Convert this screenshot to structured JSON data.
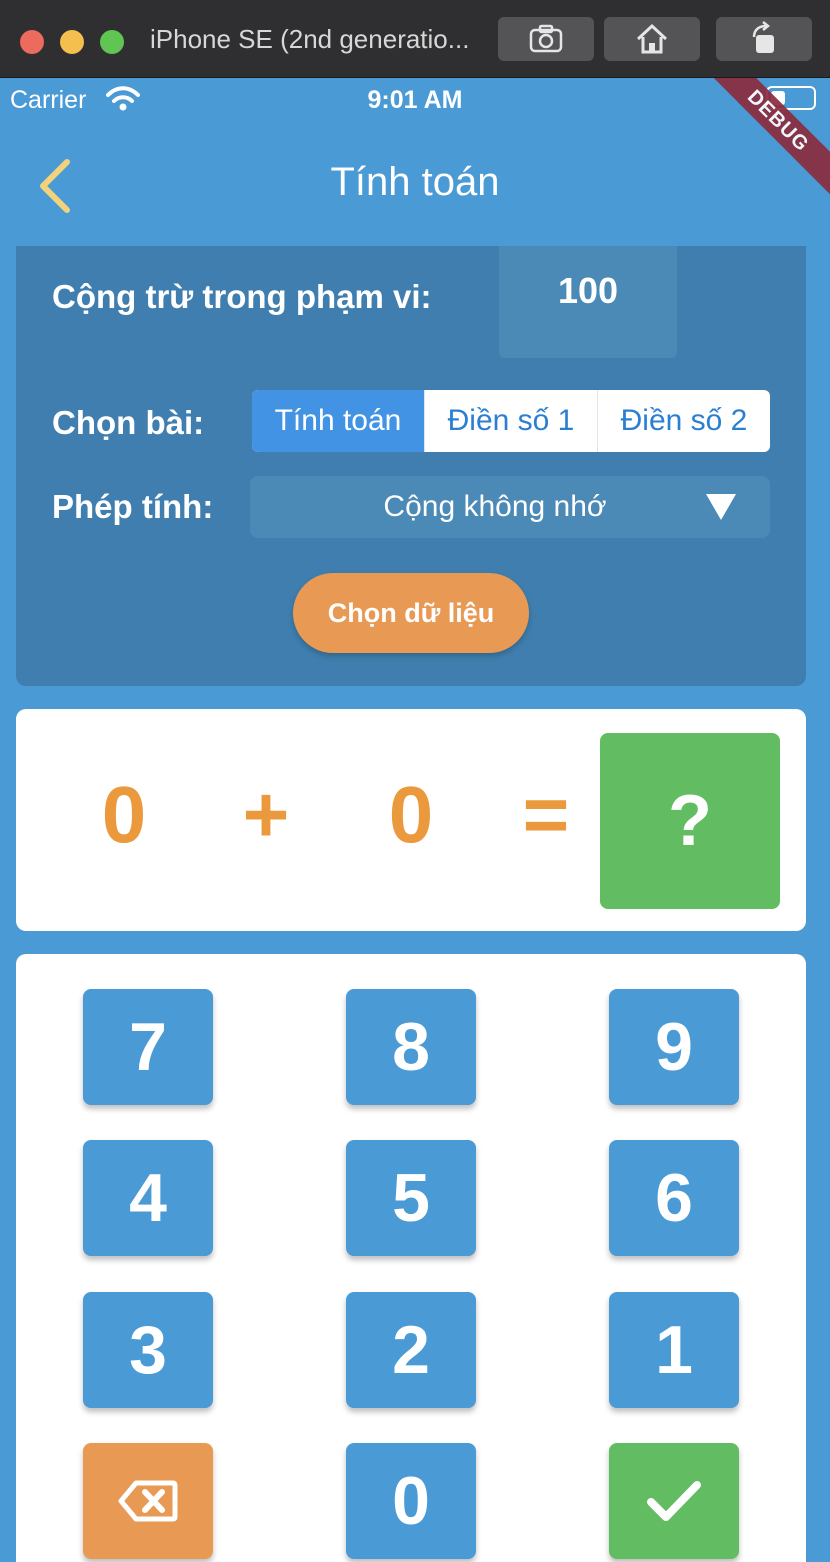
{
  "window": {
    "title": "iPhone SE (2nd generatio...",
    "buttons": [
      {
        "icon": "camera-icon"
      },
      {
        "icon": "home-icon"
      },
      {
        "icon": "rotate-icon"
      }
    ]
  },
  "status_bar": {
    "carrier": "Carrier",
    "time": "9:01 AM"
  },
  "debug_banner": "DEBUG",
  "app_bar": {
    "title": "Tính toán",
    "back_icon": "chevron-left-icon"
  },
  "settings": {
    "range_label": "Cộng trừ trong phạm vi:",
    "range_value": "100",
    "exercise_label": "Chọn bài:",
    "exercise_options": [
      "Tính toán",
      "Điền số 1",
      "Điền số 2"
    ],
    "exercise_selected": "Tính toán",
    "operation_label": "Phép tính:",
    "operation_value": "Cộng không nhớ",
    "choose_button": "Chọn dữ liệu"
  },
  "equation": {
    "operand1": "0",
    "operator": "+",
    "operand2": "0",
    "equals": "=",
    "answer": "?"
  },
  "keypad": {
    "keys": [
      "7",
      "8",
      "9",
      "4",
      "5",
      "6",
      "3",
      "2",
      "1",
      "",
      "0",
      ""
    ],
    "backspace_icon": "backspace-icon",
    "submit_icon": "check-icon"
  },
  "colors": {
    "background": "#4a9ad6",
    "panel": "#3f7eae",
    "accent_orange": "#e89a55",
    "accent_green": "#62bc61",
    "segment_active": "#4293e4",
    "back_icon": "#f3d37a"
  }
}
